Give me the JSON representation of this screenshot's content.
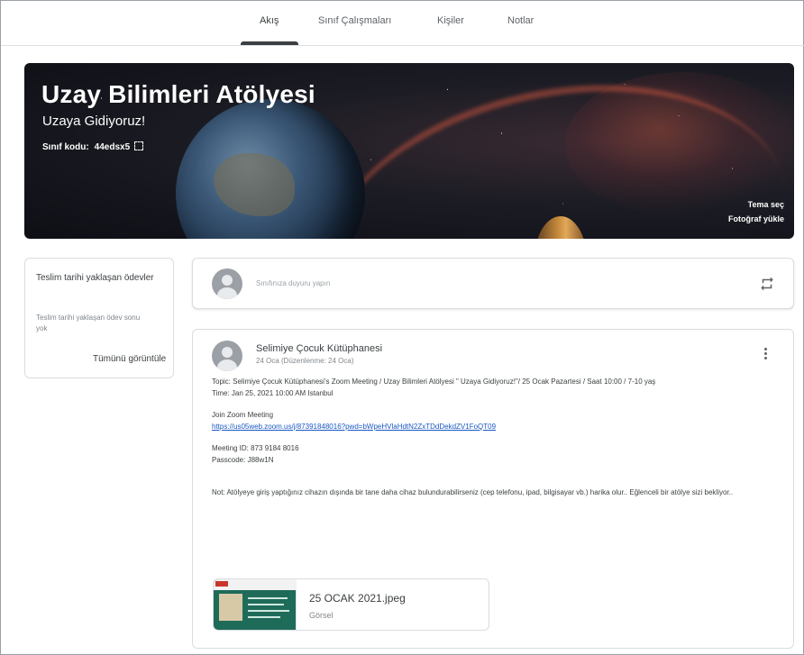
{
  "tabs": [
    {
      "label": "Akış",
      "active": true
    },
    {
      "label": "Sınıf Çalışmaları",
      "active": false
    },
    {
      "label": "Kişiler",
      "active": false
    },
    {
      "label": "Notlar",
      "active": false
    }
  ],
  "banner": {
    "title": "Uzay Bilimleri Atölyesi",
    "subtitle": "Uzaya Gidiyoruz!",
    "class_code_label": "Sınıf kodu:",
    "class_code": "44edsx5",
    "theme_link": "Tema seç",
    "upload_link": "Fotoğraf yükle"
  },
  "upcoming": {
    "title": "Teslim tarihi yaklaşan ödevler",
    "empty_text": "Teslim tarihi yaklaşan ödev sonu yok",
    "view_all": "Tümünü görüntüle"
  },
  "composer": {
    "placeholder": "Sınıfınıza duyuru yapın"
  },
  "post": {
    "author": "Selimiye Çocuk Kütüphanesi",
    "date": "24 Oca (Düzenlenme: 24 Oca)",
    "topic": "Topic: Selimiye Çocuk Kütüphanesi's Zoom Meeting / Uzay Bilimleri Atölyesi \" Uzaya Gidiyoruz!\"/ 25 Ocak Pazartesi / Saat 10:00 / 7-10 yaş",
    "time": "Time: Jan 25, 2021 10:00 AM Istanbul",
    "join_label": "Join Zoom Meeting",
    "join_link": "https://us05web.zoom.us/j/87391848016?pwd=bWpeHVlaHdtN2ZxTDdDekdZV1FoQT09",
    "meeting_id": "Meeting ID: 873 9184 8016",
    "passcode": "Passcode: J88w1N",
    "note": "Not: Atölyeye giriş yaptığınız cihazın dışında bir tane daha cihaz bulundurabilirseniz (cep telefonu, ipad, bilgisayar vb.) harika olur.. Eğlenceli bir atölye sizi bekliyor..",
    "attachment_name": "25 OCAK 2021.jpeg",
    "attachment_type": "Görsel"
  }
}
